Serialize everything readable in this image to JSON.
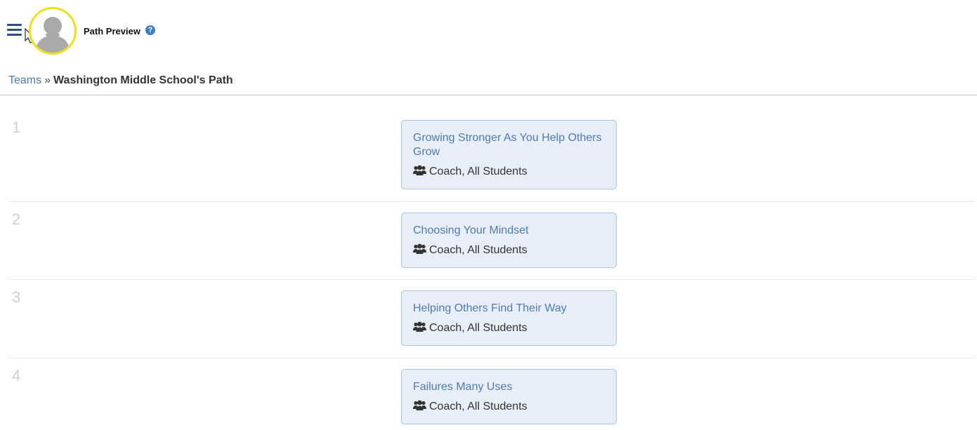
{
  "header": {
    "title": "Path Preview",
    "help_glyph": "?"
  },
  "breadcrumb": {
    "parent": "Teams",
    "separator": "»",
    "current": "Washington Middle School's Path"
  },
  "steps": [
    {
      "number": "1",
      "title": "Growing Stronger As You Help Others Grow",
      "audience": "Coach, All Students"
    },
    {
      "number": "2",
      "title": "Choosing Your Mindset",
      "audience": "Coach, All Students"
    },
    {
      "number": "3",
      "title": "Helping Others Find Their Way",
      "audience": "Coach, All Students"
    },
    {
      "number": "4",
      "title": "Failures Many Uses",
      "audience": "Coach, All Students"
    }
  ],
  "icons": {
    "menu": "hamburger-menu-icon",
    "help": "question-circle-icon",
    "audience": "users-group-icon",
    "avatar": "default-user-silhouette"
  },
  "colors": {
    "link": "#4f7ab2",
    "card_background": "#e8eef7",
    "card_border": "#a9c4e6",
    "avatar_ring": "#f0e01a",
    "menu_icon": "#2c4f86",
    "help_icon": "#3d7cc7"
  }
}
